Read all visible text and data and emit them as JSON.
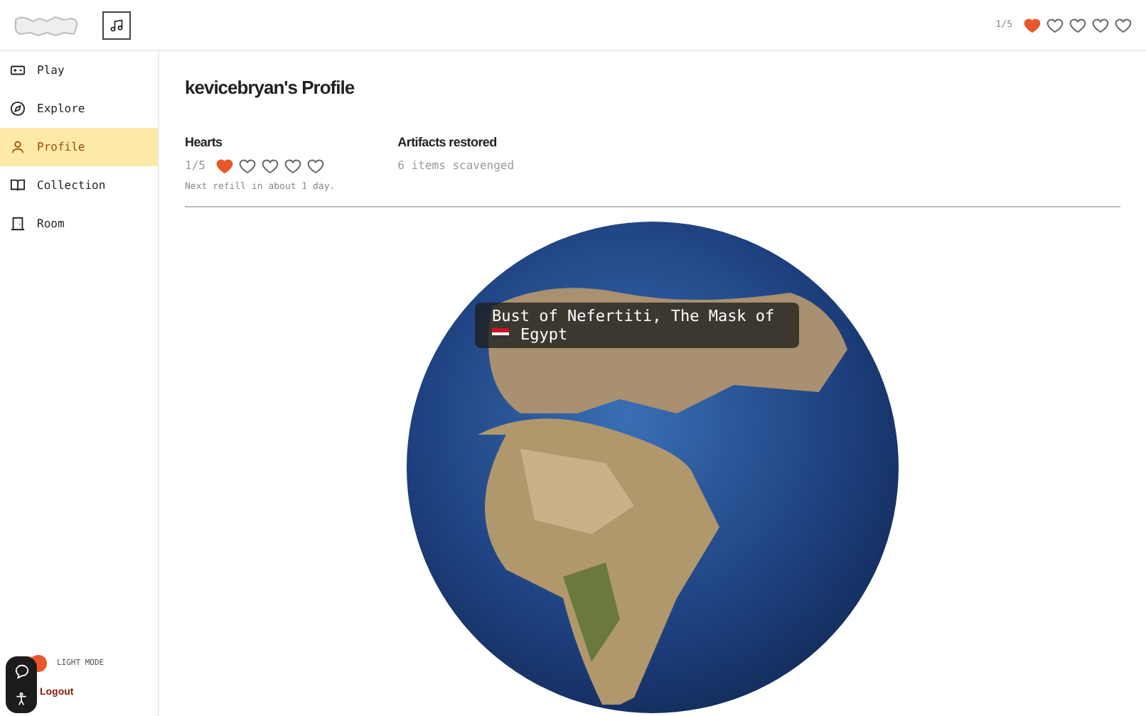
{
  "header": {
    "hearts_count": "1/5",
    "hearts": [
      {
        "filled": true
      },
      {
        "filled": false
      },
      {
        "filled": false
      },
      {
        "filled": false
      },
      {
        "filled": false
      }
    ]
  },
  "nav": [
    {
      "label": "Play",
      "selected": false
    },
    {
      "label": "Explore",
      "selected": false
    },
    {
      "label": "Profile",
      "selected": true
    },
    {
      "label": "Collection",
      "selected": false
    },
    {
      "label": "Room",
      "selected": false
    }
  ],
  "theme_toggle": {
    "label": "LIGHT MODE",
    "on": true
  },
  "logout": "Logout",
  "profile": {
    "title": "kevicebryan's Profile",
    "hearts": {
      "label": "Hearts",
      "count": "1/5",
      "hearts": [
        {
          "filled": true
        },
        {
          "filled": false
        },
        {
          "filled": false
        },
        {
          "filled": false
        },
        {
          "filled": false
        }
      ],
      "note": "Next refill in about 1 day."
    },
    "artifacts": {
      "label": "Artifacts restored",
      "text": "6 items scavenged"
    }
  },
  "globe": {
    "tooltip": {
      "title": "Bust of Nefertiti, The Mask of",
      "country": "Egypt"
    }
  }
}
